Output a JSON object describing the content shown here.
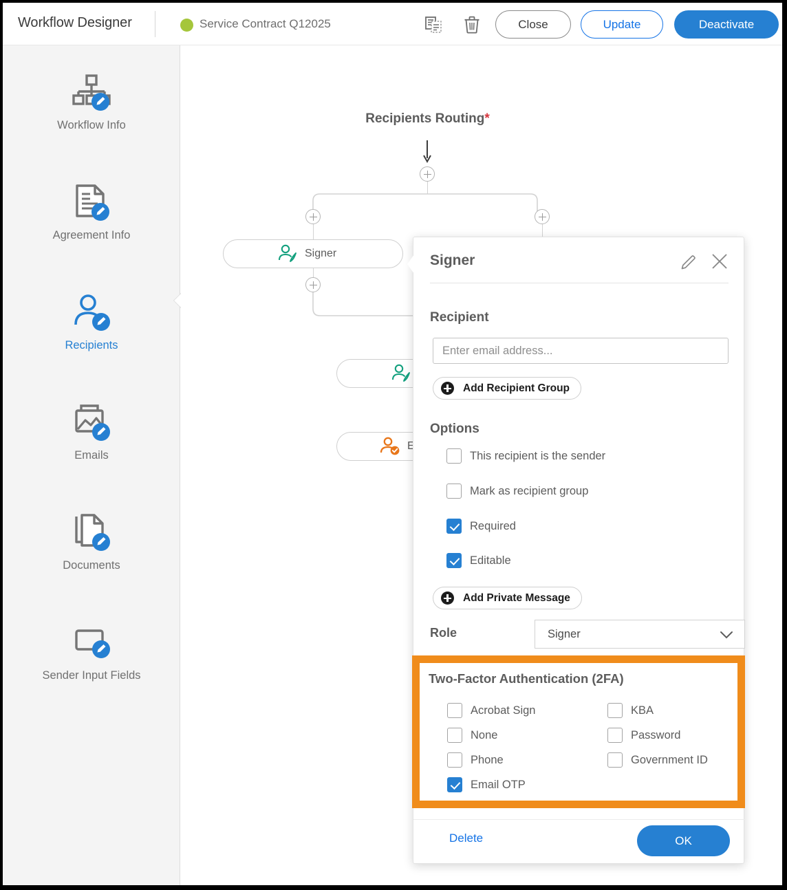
{
  "header": {
    "app_title": "Workflow Designer",
    "status_dot_color": "#a5c63b",
    "document_name": "Service Contract Q12025",
    "copy_icon": "copy-document-icon",
    "delete_icon": "trash-icon",
    "close_label": "Close",
    "update_label": "Update",
    "deactivate_label": "Deactivate"
  },
  "sidebar": {
    "items": [
      {
        "label": "Workflow Info",
        "icon": "workflow-tree-edit-icon",
        "active": false
      },
      {
        "label": "Agreement Info",
        "icon": "document-edit-icon",
        "active": false
      },
      {
        "label": "Recipients",
        "icon": "person-edit-icon",
        "active": true
      },
      {
        "label": "Emails",
        "icon": "email-image-edit-icon",
        "active": false
      },
      {
        "label": "Documents",
        "icon": "documents-edit-icon",
        "active": false
      },
      {
        "label": "Sender Input Fields",
        "icon": "input-field-edit-icon",
        "active": false
      }
    ]
  },
  "canvas": {
    "routing_title": "Recipients Routing",
    "routing_required_marker": "*",
    "nodes": [
      {
        "label": "Signer",
        "icon": "signer-pen-icon",
        "icon_color": "#13a07e"
      },
      {
        "label": "",
        "icon": "signer-pen-icon",
        "icon_color": "#13a07e"
      },
      {
        "label": "E",
        "icon": "approver-check-icon",
        "icon_color": "#e8761a"
      }
    ],
    "add_buttons": "plus-node-button"
  },
  "panel": {
    "title": "Signer",
    "edit_icon": "pencil-icon",
    "close_icon": "close-icon",
    "recipient_section": {
      "heading": "Recipient",
      "email_value": "",
      "email_placeholder": "Enter email address...",
      "add_group_label": "Add Recipient Group"
    },
    "options_section": {
      "heading": "Options",
      "checkboxes": [
        {
          "label": "This recipient is the sender",
          "checked": false
        },
        {
          "label": "Mark as recipient group",
          "checked": false
        },
        {
          "label": "Required",
          "checked": true
        },
        {
          "label": "Editable",
          "checked": true
        }
      ],
      "add_private_message_label": "Add Private Message"
    },
    "role": {
      "label": "Role",
      "selected": "Signer"
    },
    "tfa_section": {
      "heading": "Two-Factor Authentication (2FA)",
      "highlight_color": "#f08c1b",
      "left_column": [
        {
          "label": "Acrobat Sign",
          "checked": false
        },
        {
          "label": "None",
          "checked": false
        },
        {
          "label": "Phone",
          "checked": false
        },
        {
          "label": "Email OTP",
          "checked": true
        }
      ],
      "right_column": [
        {
          "label": "KBA",
          "checked": false
        },
        {
          "label": "Password",
          "checked": false
        },
        {
          "label": "Government ID",
          "checked": false
        }
      ]
    },
    "footer": {
      "delete_label": "Delete",
      "ok_label": "OK"
    }
  },
  "colors": {
    "accent_blue": "#2680d2",
    "link_blue": "#1473e6",
    "highlight_orange": "#f08c1b",
    "required_red": "#d7373f",
    "signer_green": "#13a07e",
    "approver_orange": "#e8761a"
  }
}
